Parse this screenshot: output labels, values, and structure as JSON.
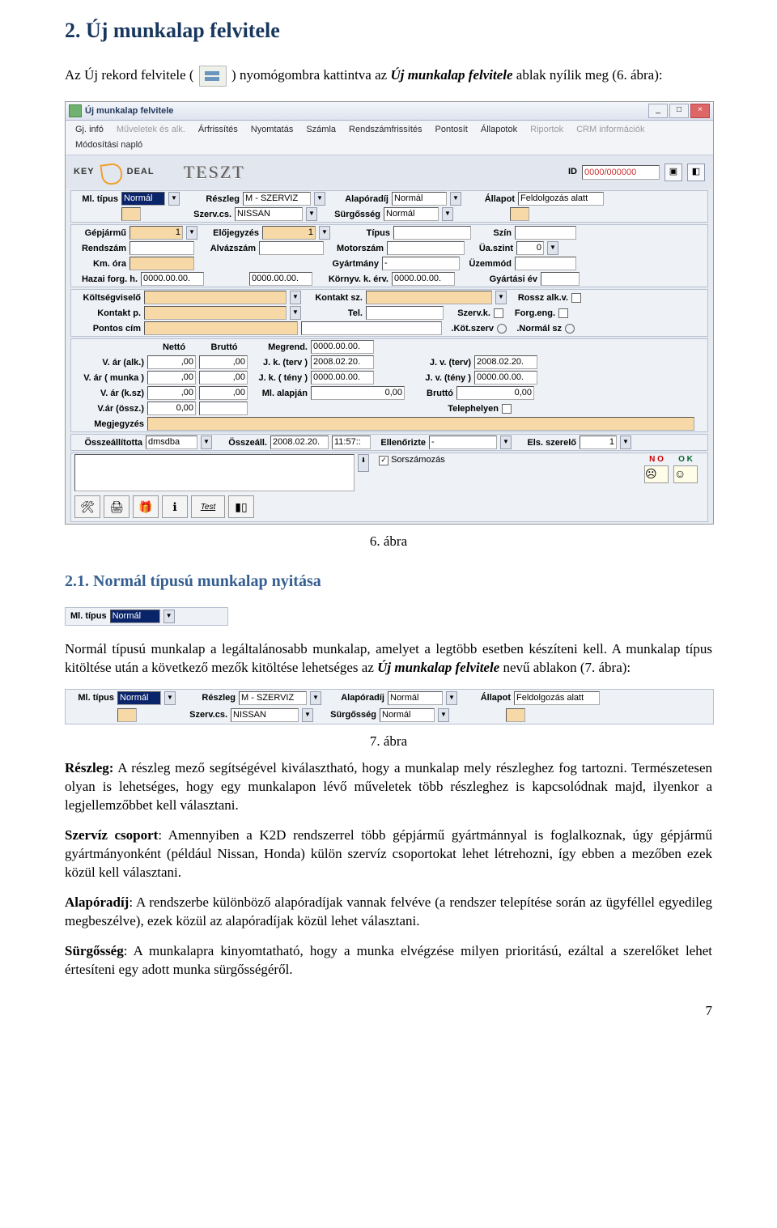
{
  "doc": {
    "h2": "2. Új munkalap felvitele",
    "intro_a": "Az Új rekord felvitele (",
    "intro_b": ") nyomógombra kattintva az ",
    "intro_em": "Új munkalap felvitele",
    "intro_c": " ablak nyílik meg (6. ábra):",
    "fig6": "6. ábra",
    "h3": "2.1. Normál típusú munkalap nyitása",
    "p2a": "Normál típusú munkalap a legáltalánosabb munkalap, amelyet a legtöbb esetben készíteni kell. A munkalap típus kitöltése után a következő mezők kitöltése lehetséges az ",
    "p2em": "Új munkalap felvitele",
    "p2b": " nevű ablakon (7. ábra):",
    "fig7": "7. ábra",
    "para_reszleg_lbl": "Részleg:",
    "para_reszleg": " A részleg mező segítségével kiválasztható, hogy a munkalap mely részleghez fog tartozni. Természetesen olyan is lehetséges, hogy egy munkalapon lévő műveletek több részleghez is kapcsolódnak majd, ilyenkor a legjellemzőbbet kell választani.",
    "para_szerviz_lbl": "Szervíz csoport",
    "para_szerviz": ": Amennyiben a K2D rendszerrel több gépjármű gyártmánnyal is foglalkoznak, úgy gépjármű gyártmányonként (például Nissan, Honda) külön szervíz csoportokat lehet létrehozni, így ebben a mezőben ezek közül kell választani.",
    "para_alap_lbl": "Alapóradíj",
    "para_alap": ": A rendszerbe különböző alapóradíjak vannak felvéve (a rendszer telepítése során az ügyféllel egyedileg megbeszélve), ezek közül az alapóradíjak közül lehet választani.",
    "para_surg_lbl": "Sürgősség",
    "para_surg": ": A munkalapra kinyomtatható, hogy a munka elvégzése milyen prioritású, ezáltal a szerelőket lehet értesíteni egy adott munka sürgősségéről.",
    "page": "7"
  },
  "snip": {
    "mltipus": "Ml. típus",
    "normal": "Normál"
  },
  "win": {
    "title": "Új munkalap felvitele",
    "menu": [
      "Gj. infó",
      "Műveletek és alk.",
      "Árfrissítés",
      "Nyomtatás",
      "Számla",
      "Rendszámfrissítés",
      "Pontosít",
      "Állapotok",
      "Riportok",
      "CRM információk",
      "Módosítási napló"
    ],
    "menu_dim": [
      1,
      8,
      9
    ],
    "brand_a": "KEY",
    "brand_b": "DEAL",
    "teszt": "TESZT",
    "id_label": "ID",
    "id_value": "0000/000000",
    "r1": {
      "mltipus": "Ml. típus",
      "mltipus_v": "Normál",
      "reszleg": "Részleg",
      "reszleg_v": "M - SZERVIZ",
      "alap": "Alapóradíj",
      "alap_v": "Normál",
      "allapot": "Állapot",
      "allapot_v": "Feldolgozás alatt",
      "szervcs": "Szerv.cs.",
      "szervcs_v": "NISSAN",
      "surg": "Sürgősség",
      "surg_v": "Normál"
    },
    "r2": {
      "gepjarmu": "Gépjármű",
      "gepjarmu_v": "1",
      "elojegy": "Előjegyzés",
      "elojegy_v": "1",
      "tipus": "Típus",
      "szin": "Szín",
      "rendszam": "Rendszám",
      "alvaz": "Alvázszám",
      "motor": "Motorszám",
      "uaszint": "Üa.szint",
      "uaszint_v": "0",
      "km": "Km. óra",
      "gyart": "Gyártmány",
      "gyart_v": "-",
      "uzem": "Üzemmód",
      "hazai": "Hazai forg. h.",
      "hazai_v": "0000.00.00.",
      "hazai2_v": "0000.00.00.",
      "kornyv": "Környv. k. érv.",
      "kornyv_v": "0000.00.00.",
      "gyev": "Gyártási év"
    },
    "r3": {
      "kviselo": "Költségviselő",
      "ksz": "Kontakt sz.",
      "rossz": "Rossz alk.v.",
      "kp": "Kontakt p.",
      "tel": "Tel.",
      "szervk": "Szerv.k.",
      "forg": "Forg.eng.",
      "pontos": "Pontos cím",
      "kotsz": ".Köt.szerv",
      "normsz": ".Normál sz"
    },
    "r4": {
      "netto": "Nettó",
      "brutto": "Bruttó",
      "valk": "V. ár (alk.)",
      "valk_n": ",00",
      "valk_b": ",00",
      "vmunka": "V. ár ( munka )",
      "vmunka_n": ",00",
      "vmunka_b": ",00",
      "vksz": "V. ár (k.sz)",
      "vksz_n": ",00",
      "vksz_b": ",00",
      "vossz": "V.ár (össz.)",
      "vossz_n": "0,00",
      "megrend": "Megrend.",
      "megrend_v": "0000.00.00.",
      "jkterv": "J. k. (terv )",
      "jkterv_v": "2008.02.20.",
      "jvterv": "J. v. (terv)",
      "jvterv_v": "2008.02.20.",
      "jkteny": "J. k. ( tény )",
      "jkteny_v": "0000.00.00.",
      "jvteny": "J. v. (tény )",
      "jvteny_v": "0000.00.00.",
      "mlalap": "Ml. alapján",
      "mlalap_v": "0,00",
      "brutto2": "Bruttó",
      "brutto2_v": "0,00",
      "megj": "Megjegyzés",
      "telep": "Telephelyen"
    },
    "r5": {
      "ossze": "Összeállította",
      "ossze_v": "dmsdba",
      "osszd": "Összeáll.",
      "osszd_v": "2008.02.20.",
      "osszt": "11:57::",
      "ellen": "Ellenőrizte",
      "ellen_v": "-",
      "szerelo": "Els. szerelő",
      "szerelo_v": "1"
    },
    "sorsz": "Sorszámozás",
    "no": "N O",
    "ok": "O K",
    "tb_test": "Test"
  },
  "strip": {
    "mltipus": "Ml. típus",
    "mltipus_v": "Normál",
    "reszleg": "Részleg",
    "reszleg_v": "M - SZERVIZ",
    "alap": "Alapóradíj",
    "alap_v": "Normál",
    "allapot": "Állapot",
    "allapot_v": "Feldolgozás alatt",
    "szervcs": "Szerv.cs.",
    "szervcs_v": "NISSAN",
    "surg": "Sürgősség",
    "surg_v": "Normál"
  }
}
